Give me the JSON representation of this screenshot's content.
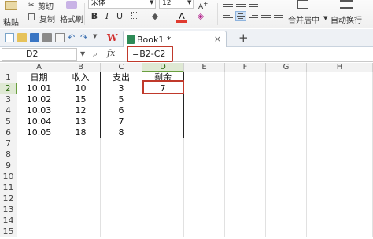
{
  "ribbon": {
    "paste": "粘贴",
    "cut": "剪切",
    "copy": "复制",
    "format_painter": "格式刷",
    "font_name": "宋体",
    "font_size": "12",
    "bold": "B",
    "italic": "I",
    "underline": "U",
    "font_color": "A",
    "merge_center": "合并居中",
    "wrap_text": "自动换行"
  },
  "tabs": {
    "doc_name": "Book1 *",
    "new_tab": "+",
    "close": "×",
    "logo_text": "W"
  },
  "formula_bar": {
    "name_box": "D2",
    "fx": "fx",
    "formula": "=B2-C2"
  },
  "columns": [
    "A",
    "B",
    "C",
    "D",
    "E",
    "F",
    "G",
    "H"
  ],
  "rows": [
    "1",
    "2",
    "3",
    "4",
    "5",
    "6",
    "7",
    "8",
    "9",
    "10",
    "11",
    "12",
    "13",
    "14",
    "15"
  ],
  "table": {
    "headers": [
      "日期",
      "收入",
      "支出",
      "剩余"
    ],
    "data": [
      [
        "10.01",
        "10",
        "3",
        "7"
      ],
      [
        "10.02",
        "15",
        "5",
        ""
      ],
      [
        "10.03",
        "12",
        "6",
        ""
      ],
      [
        "10.04",
        "13",
        "7",
        ""
      ],
      [
        "10.05",
        "18",
        "8",
        ""
      ]
    ]
  },
  "selection": {
    "active_cell": "D2"
  },
  "colors": {
    "highlight": "#c0392b",
    "selected_header": "#dfe9d4"
  }
}
